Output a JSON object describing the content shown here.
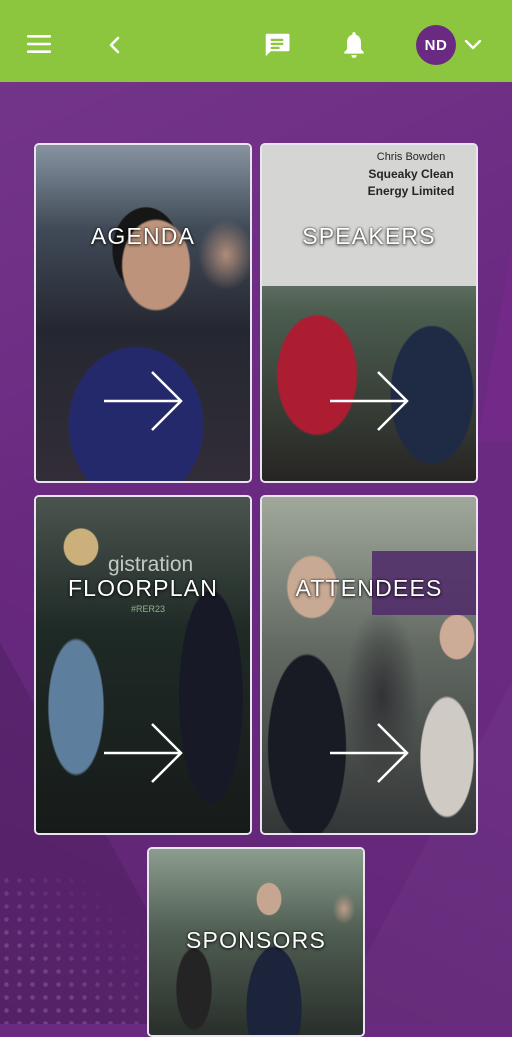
{
  "appbar": {
    "background": "#8cc63f",
    "menu_icon": "menu-icon",
    "back_icon": "back-chevron-icon",
    "chat_icon": "chat-icon",
    "bell_icon": "bell-icon",
    "avatar_initials": "ND",
    "avatar_color": "#6b2a82",
    "dropdown_icon": "chevron-down-icon"
  },
  "tiles": [
    {
      "label": "AGENDA"
    },
    {
      "label": "SPEAKERS",
      "photo_text": [
        "Chris Bowden",
        "Squeaky Clean",
        "Energy Limited"
      ]
    },
    {
      "label": "FLOORPLAN",
      "photo_text": [
        "gistration",
        "#RER23"
      ]
    },
    {
      "label": "ATTENDEES"
    },
    {
      "label": "SPONSORS"
    }
  ],
  "arrow_icon": "arrow-right-icon",
  "background_color": "#6b2a82"
}
